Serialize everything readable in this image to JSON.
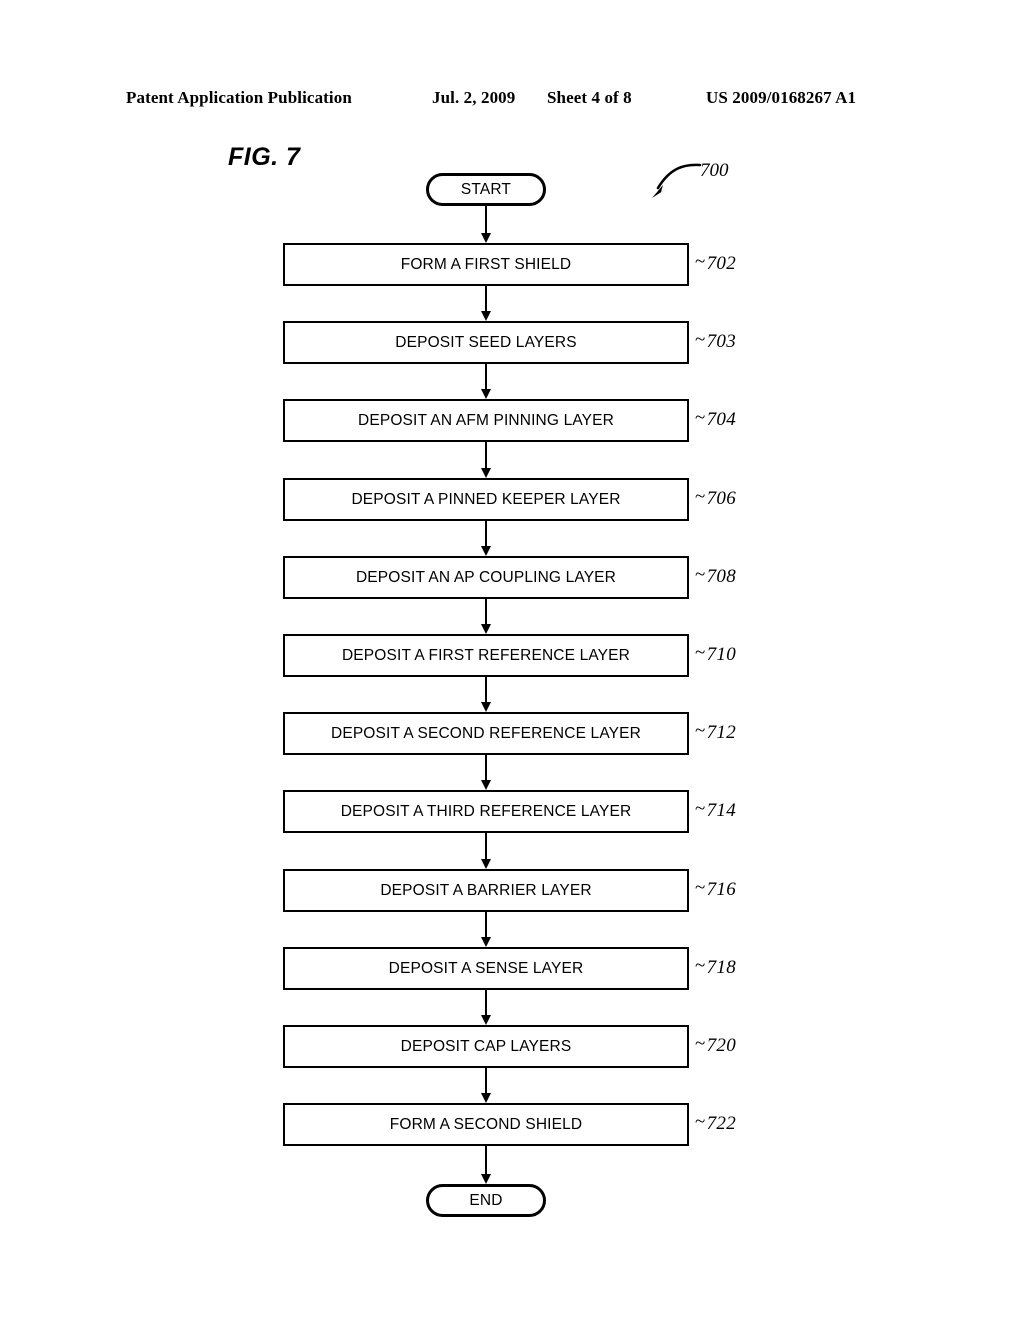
{
  "header": {
    "publication": "Patent Application Publication",
    "date": "Jul. 2, 2009",
    "sheet": "Sheet 4 of 8",
    "patent_number": "US 2009/0168267 A1"
  },
  "figure": {
    "label": "FIG. 7",
    "diagram_reference": "700",
    "tilde": "~"
  },
  "flow": {
    "start": {
      "label": "START"
    },
    "end": {
      "label": "END"
    },
    "steps": [
      {
        "label": "FORM A FIRST SHIELD",
        "ref": "702"
      },
      {
        "label": "DEPOSIT SEED LAYERS",
        "ref": "703"
      },
      {
        "label": "DEPOSIT AN AFM PINNING LAYER",
        "ref": "704"
      },
      {
        "label": "DEPOSIT A PINNED KEEPER LAYER",
        "ref": "706"
      },
      {
        "label": "DEPOSIT AN AP COUPLING LAYER",
        "ref": "708"
      },
      {
        "label": "DEPOSIT A FIRST REFERENCE LAYER",
        "ref": "710"
      },
      {
        "label": "DEPOSIT A SECOND REFERENCE LAYER",
        "ref": "712"
      },
      {
        "label": "DEPOSIT A THIRD REFERENCE LAYER",
        "ref": "714"
      },
      {
        "label": "DEPOSIT A BARRIER LAYER",
        "ref": "716"
      },
      {
        "label": "DEPOSIT A SENSE LAYER",
        "ref": "718"
      },
      {
        "label": "DEPOSIT CAP LAYERS",
        "ref": "720"
      },
      {
        "label": "FORM A SECOND SHIELD",
        "ref": "722"
      }
    ]
  },
  "colors": {
    "ink": "#000000",
    "paper": "#ffffff"
  }
}
